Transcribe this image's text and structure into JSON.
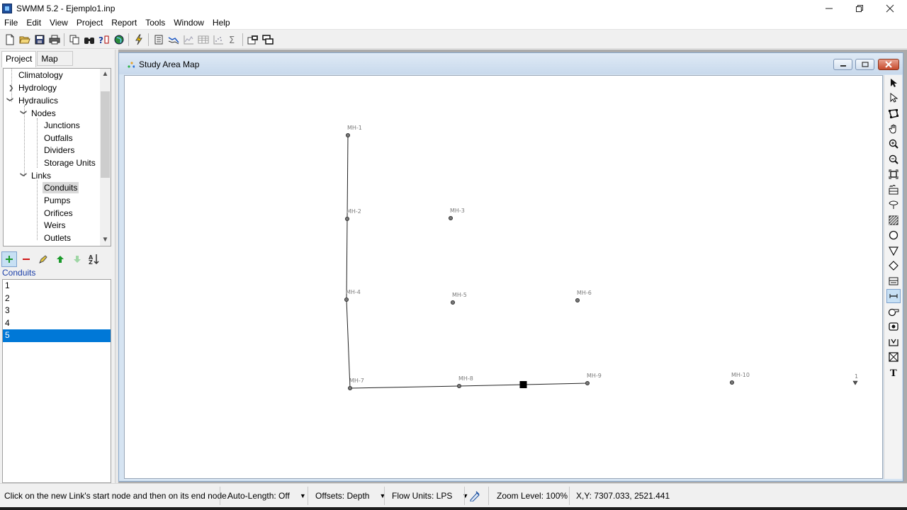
{
  "window": {
    "title": "SWMM 5.2 - Ejemplo1.inp",
    "minimize_icon": "minimize-icon",
    "restore_icon": "restore-icon",
    "close_icon": "close-icon"
  },
  "menu": [
    "File",
    "Edit",
    "View",
    "Project",
    "Report",
    "Tools",
    "Window",
    "Help"
  ],
  "toolbar_icons": [
    "new-file-icon",
    "open-folder-icon",
    "save-icon",
    "print-icon",
    "copy-icon",
    "find-icon",
    "query-icon",
    "overview-map-icon",
    "run-simulation-icon",
    "status-report-icon",
    "profile-plot-icon",
    "time-series-plot-icon",
    "table-icon",
    "scatter-plot-icon",
    "statistics-icon",
    "map-options-icon",
    "arrange-windows-icon"
  ],
  "left_panel": {
    "tabs": [
      "Project",
      "Map"
    ],
    "active_tab": "Project",
    "tree": [
      {
        "label": "Climatology",
        "level": 0,
        "expander": "",
        "selected": false
      },
      {
        "label": "Hydrology",
        "level": 0,
        "expander": "collapsed",
        "selected": false
      },
      {
        "label": "Hydraulics",
        "level": 0,
        "expander": "expanded",
        "selected": false
      },
      {
        "label": "Nodes",
        "level": 1,
        "expander": "expanded",
        "selected": false
      },
      {
        "label": "Junctions",
        "level": 2,
        "expander": "",
        "selected": false
      },
      {
        "label": "Outfalls",
        "level": 2,
        "expander": "",
        "selected": false
      },
      {
        "label": "Dividers",
        "level": 2,
        "expander": "",
        "selected": false
      },
      {
        "label": "Storage Units",
        "level": 2,
        "expander": "",
        "selected": false
      },
      {
        "label": "Links",
        "level": 1,
        "expander": "expanded",
        "selected": false
      },
      {
        "label": "Conduits",
        "level": 2,
        "expander": "",
        "selected": true
      },
      {
        "label": "Pumps",
        "level": 2,
        "expander": "",
        "selected": false
      },
      {
        "label": "Orifices",
        "level": 2,
        "expander": "",
        "selected": false
      },
      {
        "label": "Weirs",
        "level": 2,
        "expander": "",
        "selected": false
      },
      {
        "label": "Outlets",
        "level": 2,
        "expander": "",
        "selected": false
      }
    ],
    "list_toolbar_icons": [
      "add-icon",
      "delete-icon",
      "edit-icon",
      "move-up-icon",
      "move-down-icon",
      "sort-icon"
    ],
    "list_caption": "Conduits",
    "list_items": [
      "1",
      "2",
      "3",
      "4",
      "5"
    ],
    "selected_item": "5"
  },
  "map_window": {
    "title": "Study Area Map",
    "nodes": [
      {
        "id": "MH-1"
      },
      {
        "id": "MH-2"
      },
      {
        "id": "MH-3"
      },
      {
        "id": "MH-4"
      },
      {
        "id": "MH-5"
      },
      {
        "id": "MH-6"
      },
      {
        "id": "MH-7"
      },
      {
        "id": "MH-8"
      },
      {
        "id": "MH-9"
      },
      {
        "id": "MH-10"
      }
    ],
    "outfall": {
      "id": "1"
    },
    "links": [
      {
        "from": "MH-1",
        "to": "MH-2"
      },
      {
        "from": "MH-2",
        "to": "MH-4"
      },
      {
        "from": "MH-4",
        "to": "MH-7"
      },
      {
        "from": "MH-7",
        "to": "MH-8"
      },
      {
        "from": "MH-8",
        "to": "MH-9"
      }
    ],
    "tools": [
      "select-object-icon",
      "select-vertex-icon",
      "select-region-icon",
      "pan-icon",
      "zoom-in-icon",
      "zoom-out-icon",
      "full-extent-icon",
      "add-rain-gage-icon",
      "add-subcatchment-icon",
      "add-junction-icon",
      "add-outfall-icon",
      "add-divider-icon",
      "add-storage-unit-icon",
      "add-conduit-icon",
      "add-pump-icon",
      "add-orifice-icon",
      "add-weir-icon",
      "add-outlet-icon",
      "add-label-icon"
    ],
    "active_tool": "add-conduit-icon"
  },
  "status": {
    "hint": "Click on the new Link's start node and then on its end node.",
    "auto_length": "Auto-Length: Off",
    "offsets": "Offsets: Depth",
    "flow_units": "Flow Units: LPS",
    "zoom": "Zoom Level: 100%",
    "xy": "X,Y: 7307.033, 2521.441"
  }
}
